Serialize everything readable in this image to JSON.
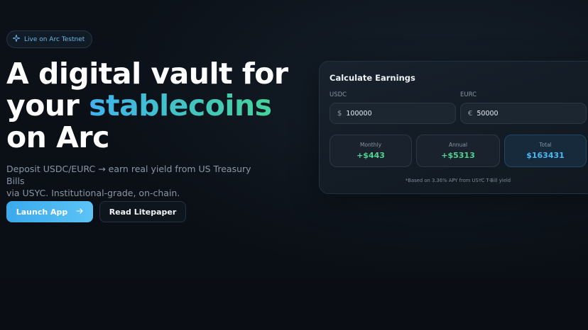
{
  "badge": {
    "icon": "sparkle-icon",
    "label": "Live on Arc Testnet"
  },
  "hero": {
    "title_line1": "A digital vault for",
    "title_line2_prefix": "your ",
    "title_line2_highlight": "stablecoins",
    "title_line3": "on Arc",
    "description_line1": "Deposit USDC/EURC → earn real yield from US Treasury Bills",
    "description_line2": "via USYC. Institutional-grade, on-chain.",
    "highlight_gradient": [
      "#3fb3ef",
      "#45d39a"
    ]
  },
  "actions": {
    "launch_label": "Launch App",
    "launch_icon": "arrow-right-icon",
    "litepaper_label": "Read Litepaper"
  },
  "calculator": {
    "title": "Calculate Earnings",
    "usdc": {
      "label": "USDC",
      "currency_symbol": "$",
      "value": "100000"
    },
    "eurc": {
      "label": "EURC",
      "currency_symbol": "€",
      "value": "50000"
    },
    "monthly": {
      "label": "Monthly",
      "value": "+$443"
    },
    "annual": {
      "label": "Annual",
      "value": "+$5313"
    },
    "total": {
      "label": "Total",
      "value": "$163431"
    },
    "footnote": "*Based on 3.36% APY from USYC T-Bill yield"
  }
}
